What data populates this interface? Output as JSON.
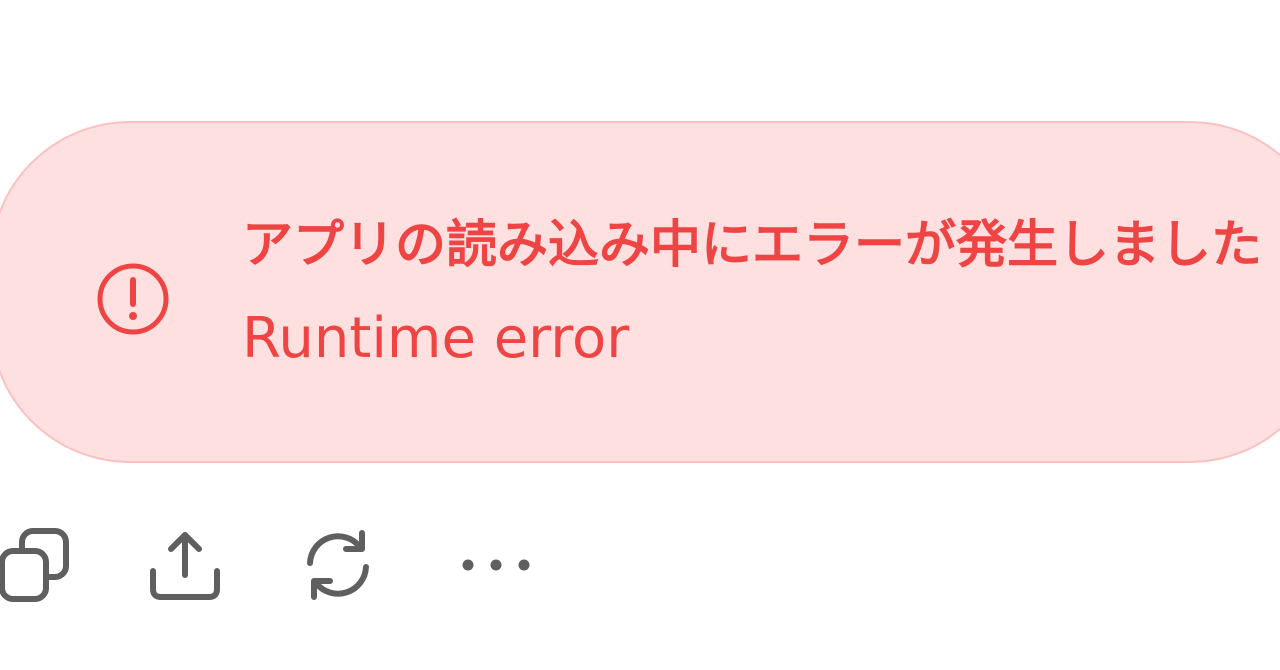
{
  "error": {
    "title": "アプリの読み込み中にエラーが発生しました",
    "detail": "Runtime error",
    "icon": "alert-circle-icon",
    "colors": {
      "background": "#fee0e0",
      "border": "#fbc1c1",
      "text": "#ef4444"
    }
  },
  "actions": [
    {
      "icon": "copy-icon"
    },
    {
      "icon": "share-icon"
    },
    {
      "icon": "refresh-icon"
    },
    {
      "icon": "more-horizontal-icon"
    }
  ],
  "colors": {
    "icon": "#5f5f5f"
  }
}
